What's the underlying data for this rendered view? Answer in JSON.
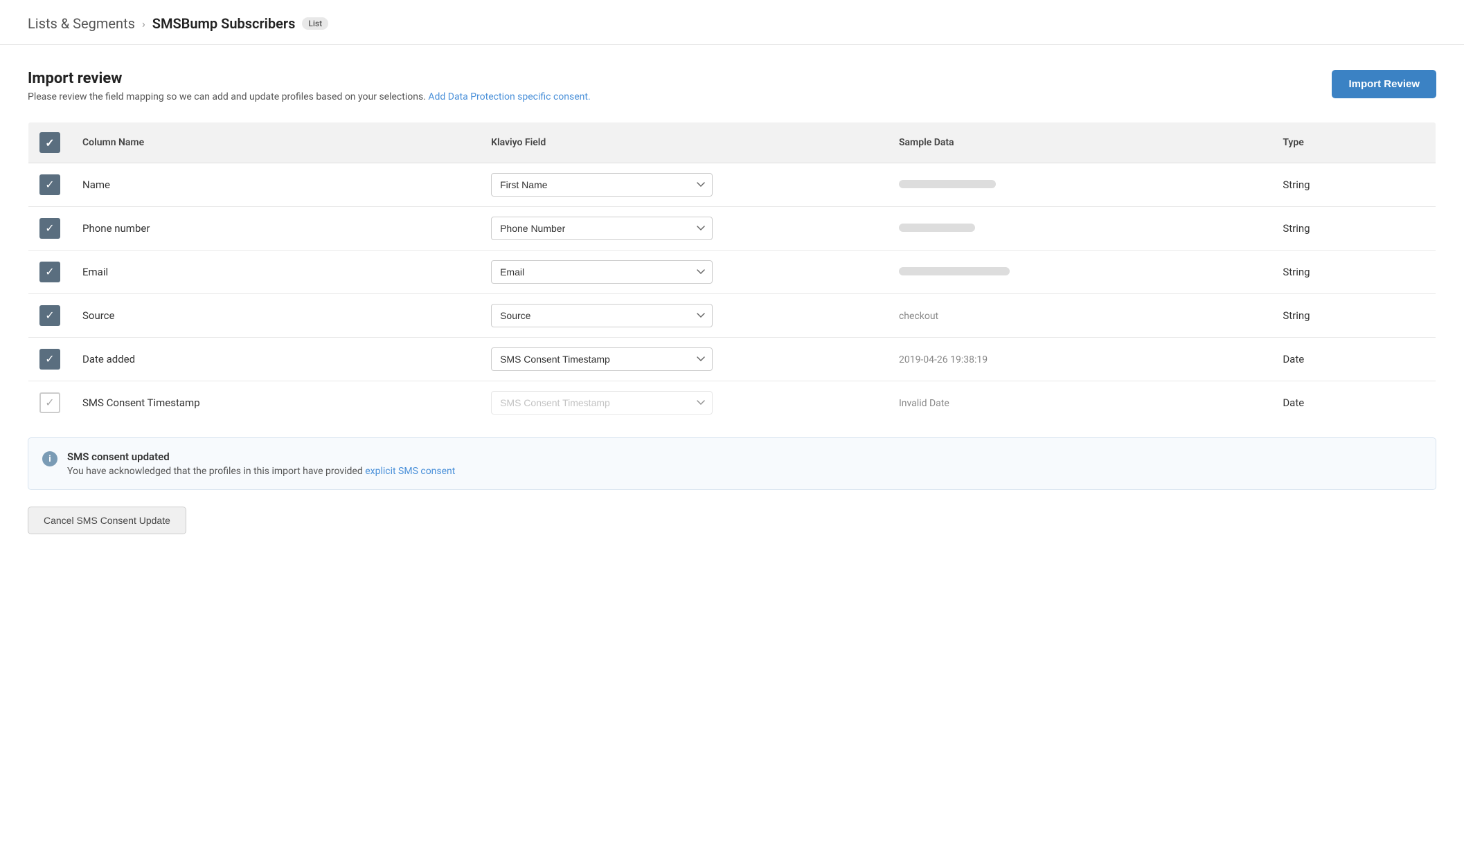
{
  "breadcrumb": {
    "parent": "Lists & Segments",
    "separator": "›",
    "current": "SMSBump Subscribers",
    "badge": "List"
  },
  "section": {
    "title": "Import review",
    "description": "Please review the field mapping so we can add and update profiles based on your selections.",
    "link_text": "Add Data Protection specific consent.",
    "import_button": "Import Review"
  },
  "table": {
    "headers": {
      "column_name": "Column Name",
      "klaviyo_field": "Klaviyo Field",
      "sample_data": "Sample Data",
      "type": "Type"
    },
    "rows": [
      {
        "id": "name",
        "checked": true,
        "disabled": false,
        "column_name": "Name",
        "klaviyo_field": "First Name",
        "sample_data_type": "placeholder",
        "sample_data_width": 140,
        "sample_data_text": "",
        "type": "String"
      },
      {
        "id": "phone_number",
        "checked": true,
        "disabled": false,
        "column_name": "Phone number",
        "klaviyo_field": "Phone Number",
        "sample_data_type": "placeholder",
        "sample_data_width": 110,
        "sample_data_text": "",
        "type": "String"
      },
      {
        "id": "email",
        "checked": true,
        "disabled": false,
        "column_name": "Email",
        "klaviyo_field": "Email",
        "sample_data_type": "placeholder",
        "sample_data_width": 160,
        "sample_data_text": "",
        "type": "String"
      },
      {
        "id": "source",
        "checked": true,
        "disabled": false,
        "column_name": "Source",
        "klaviyo_field": "Source",
        "sample_data_type": "text",
        "sample_data_text": "checkout",
        "type": "String"
      },
      {
        "id": "date_added",
        "checked": true,
        "disabled": false,
        "column_name": "Date added",
        "klaviyo_field": "SMS Consent Timestamp",
        "sample_data_type": "text",
        "sample_data_text": "2019-04-26 19:38:19",
        "type": "Date"
      },
      {
        "id": "sms_consent_timestamp",
        "checked": true,
        "disabled": true,
        "column_name": "SMS Consent Timestamp",
        "klaviyo_field": "SMS Consent Timestamp",
        "sample_data_type": "text",
        "sample_data_text": "Invalid Date",
        "type": "Date"
      }
    ]
  },
  "consent_notice": {
    "icon": "i",
    "title": "SMS consent updated",
    "description": "You have acknowledged that the profiles in this import have provided",
    "link_text": "explicit SMS consent"
  },
  "cancel_button": "Cancel SMS Consent Update"
}
